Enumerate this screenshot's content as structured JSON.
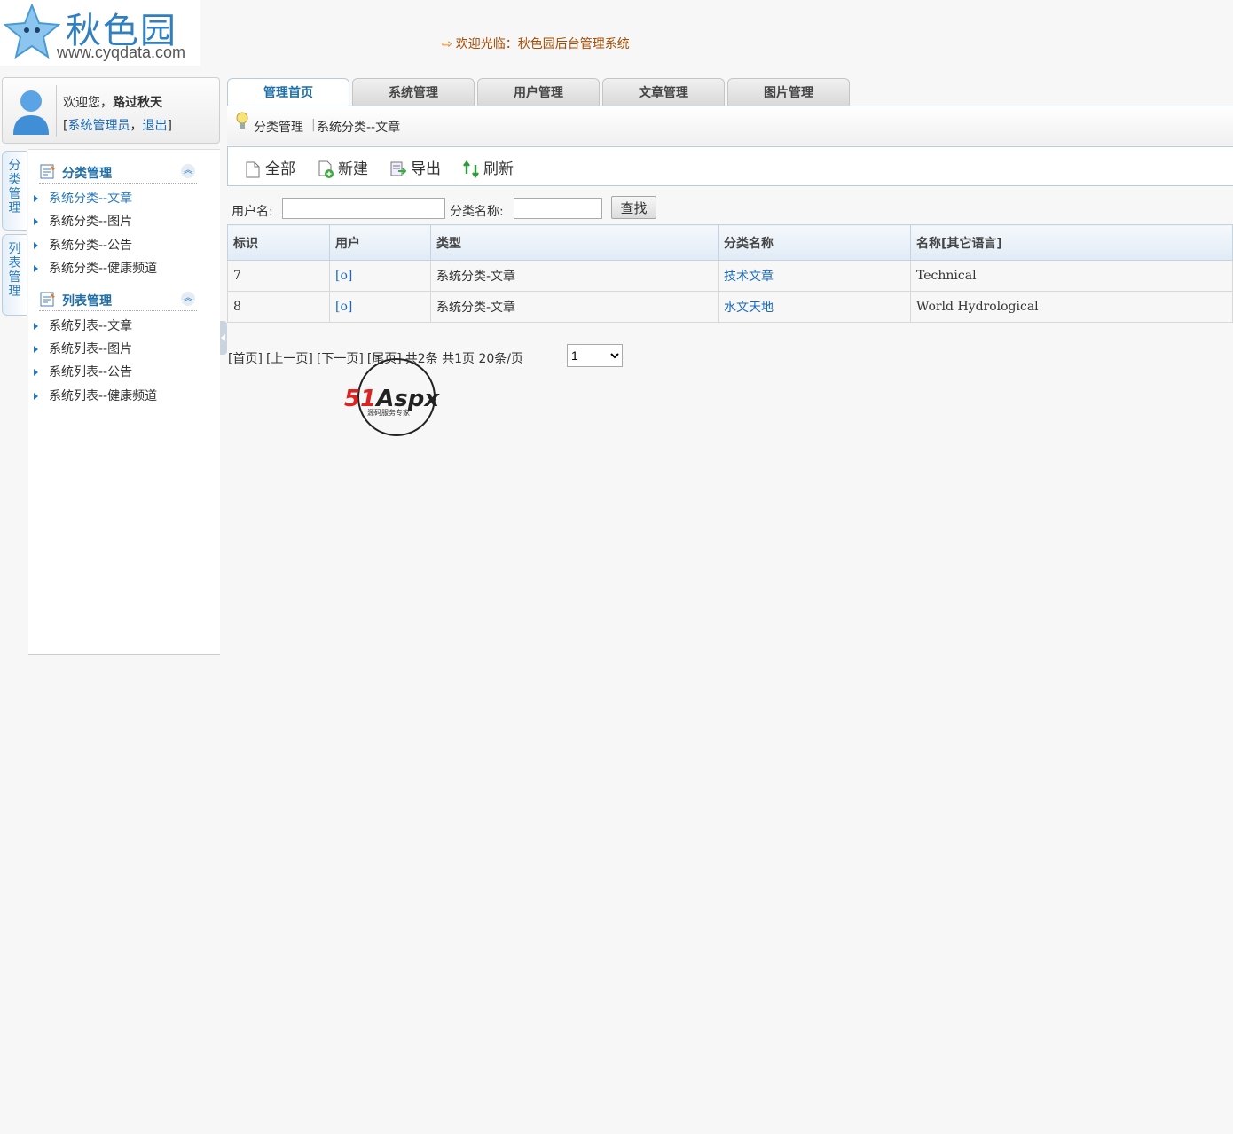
{
  "header": {
    "brand": "秋色园",
    "url": "www.cyqdata.com",
    "welcome": "欢迎光临：秋色园后台管理系统"
  },
  "user": {
    "greeting_prefix": "欢迎您，",
    "username": "路过秋天",
    "bracket_open": "[",
    "role": "系统管理员",
    "comma": "，",
    "logout": "退出",
    "bracket_close": "]"
  },
  "side_tabs": [
    "分类管理",
    "列表管理"
  ],
  "sidebar": {
    "groups": [
      {
        "title": "分类管理",
        "items": [
          "系统分类--文章",
          "系统分类--图片",
          "系统分类--公告",
          "系统分类--健康频道"
        ]
      },
      {
        "title": "列表管理",
        "items": [
          "系统列表--文章",
          "系统列表--图片",
          "系统列表--公告",
          "系统列表--健康频道"
        ]
      }
    ]
  },
  "tabs": [
    "管理首页",
    "系统管理",
    "用户管理",
    "文章管理",
    "图片管理"
  ],
  "breadcrumb": [
    "分类管理",
    "系统分类--文章"
  ],
  "toolbar": {
    "all": "全部",
    "new": "新建",
    "export": "导出",
    "refresh": "刷新"
  },
  "search": {
    "username_label": "用户名:",
    "username_value": "",
    "category_label": "分类名称:",
    "category_value": "",
    "button": "查找"
  },
  "table": {
    "headers": [
      "标识",
      "用户",
      "类型",
      "分类名称",
      "名称[其它语言]"
    ],
    "rows": [
      [
        "7",
        "[o]",
        "系统分类-文章",
        "技术文章",
        "Technical"
      ],
      [
        "8",
        "[o]",
        "系统分类-文章",
        "水文天地",
        "World Hydrological"
      ]
    ]
  },
  "pager": {
    "first": "[首页]",
    "prev": "[上一页]",
    "next": "[下一页]",
    "last": "[尾页]",
    "summary": "共2条 共1页 20条/页",
    "page_select": "1"
  },
  "watermark": {
    "logo_text": "51Aspx",
    "subtitle": "源码服务专家"
  },
  "colors": {
    "accent": "#1f6ea8",
    "link": "#1b6ab8",
    "welcome": "#a64b00"
  }
}
